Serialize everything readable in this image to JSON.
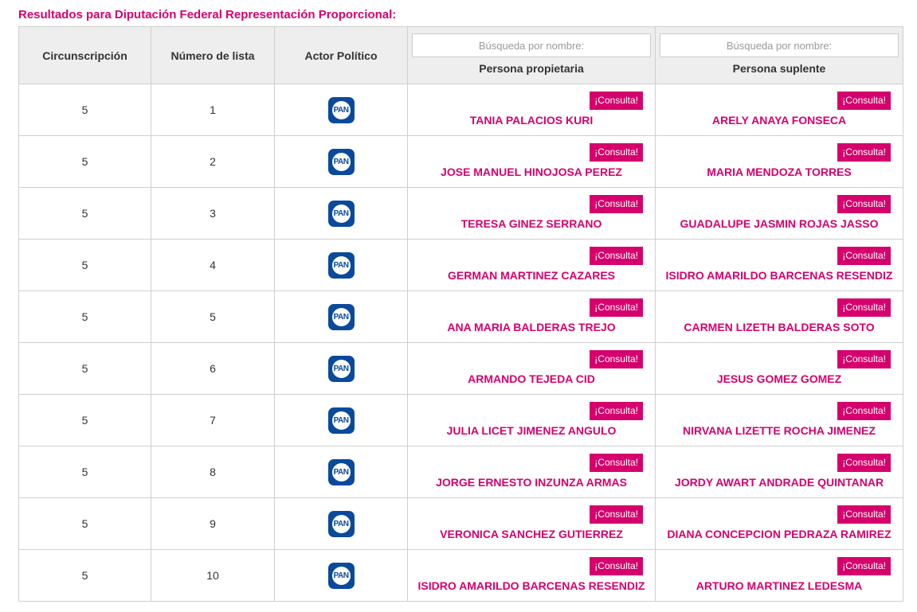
{
  "page": {
    "title": "Resultados para Diputación Federal Representación Proporcional:"
  },
  "colors": {
    "accent": "#d5006d",
    "pan_blue": "#0a4a9c"
  },
  "table": {
    "headers": {
      "circunscripcion": "Circunscripción",
      "numero_lista": "Número de lista",
      "actor_politico": "Actor Político",
      "propietaria": "Persona propietaria",
      "suplente": "Persona suplente"
    },
    "search": {
      "propietaria_placeholder": "Búsqueda por nombre:",
      "suplente_placeholder": "Búsqueda por nombre:"
    },
    "button_label": "¡Consulta!",
    "logo": {
      "icon": "pan-logo-icon",
      "text": "PAN"
    },
    "rows": [
      {
        "circ": "5",
        "num": "1",
        "prop": "TANIA PALACIOS KURI",
        "sup": "ARELY ANAYA FONSECA"
      },
      {
        "circ": "5",
        "num": "2",
        "prop": "JOSE MANUEL HINOJOSA PEREZ",
        "sup": "MARIA MENDOZA TORRES"
      },
      {
        "circ": "5",
        "num": "3",
        "prop": "TERESA GINEZ SERRANO",
        "sup": "GUADALUPE JASMIN ROJAS JASSO"
      },
      {
        "circ": "5",
        "num": "4",
        "prop": "GERMAN MARTINEZ CAZARES",
        "sup": "ISIDRO AMARILDO BARCENAS RESENDIZ"
      },
      {
        "circ": "5",
        "num": "5",
        "prop": "ANA MARIA BALDERAS TREJO",
        "sup": "CARMEN LIZETH BALDERAS SOTO"
      },
      {
        "circ": "5",
        "num": "6",
        "prop": "ARMANDO TEJEDA CID",
        "sup": "JESUS GOMEZ GOMEZ"
      },
      {
        "circ": "5",
        "num": "7",
        "prop": "JULIA LICET JIMENEZ ANGULO",
        "sup": "NIRVANA LIZETTE ROCHA JIMENEZ"
      },
      {
        "circ": "5",
        "num": "8",
        "prop": "JORGE ERNESTO INZUNZA ARMAS",
        "sup": "JORDY AWART ANDRADE QUINTANAR"
      },
      {
        "circ": "5",
        "num": "9",
        "prop": "VERONICA SANCHEZ GUTIERREZ",
        "sup": "DIANA CONCEPCION PEDRAZA RAMIREZ"
      },
      {
        "circ": "5",
        "num": "10",
        "prop": "ISIDRO AMARILDO BARCENAS RESENDIZ",
        "sup": "ARTURO MARTINEZ LEDESMA"
      }
    ]
  }
}
